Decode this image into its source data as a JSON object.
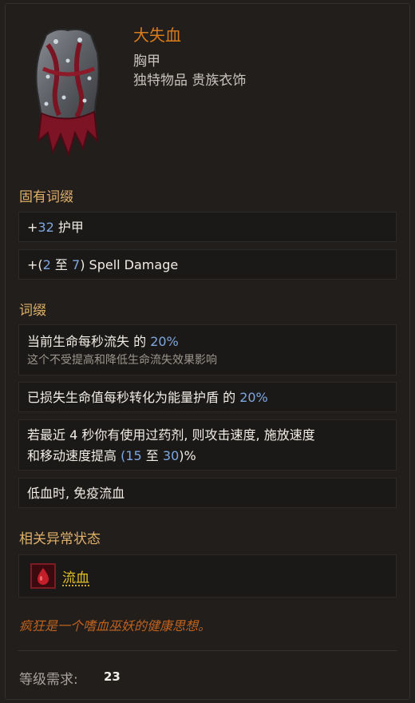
{
  "item": {
    "name": "大失血",
    "slot": "胸甲",
    "rarity_type": "独特物品 贵族衣饰",
    "icon": "chest-armor-icon",
    "name_color": "#d87c1c"
  },
  "implicit": {
    "header": "固有词缀",
    "mods": [
      {
        "prefix": "+",
        "n1": "32",
        "suffix": " 护甲"
      },
      {
        "prefix": "+(",
        "n1": "2",
        "mid": " 至 ",
        "n2": "7",
        "suffix": ") Spell Damage"
      }
    ]
  },
  "explicit": {
    "header": "词缀",
    "mods": [
      {
        "text": "当前生命每秒流失 的 ",
        "n1": "20%",
        "note": "这个不受提高和降低生命流失效果影响"
      },
      {
        "text": "已损失生命值每秒转化为能量护盾 的 ",
        "n1": "20%"
      },
      {
        "line1": "若最近 4 秒你有使用过药剂, 则攻击速度, 施放速度",
        "line2_pre": "和移动速度提高 ",
        "line2_open": "(",
        "n1": "15",
        "mid": " 至 ",
        "n2": "30",
        "line2_close": ")%"
      },
      {
        "text": "低血时, 免疫流血"
      }
    ]
  },
  "ailments": {
    "header": "相关异常状态",
    "items": [
      {
        "label": "流血",
        "icon": "bleed-drop-icon"
      }
    ]
  },
  "flavor": "疯狂是一个嗜血巫妖的健康思想。",
  "requirement": {
    "label": "等级需求:",
    "value": "23"
  },
  "colors": {
    "number": "#7ea6e0",
    "header": "#e0b06a",
    "flavor": "#c0621f",
    "link": "#e3c02a"
  }
}
